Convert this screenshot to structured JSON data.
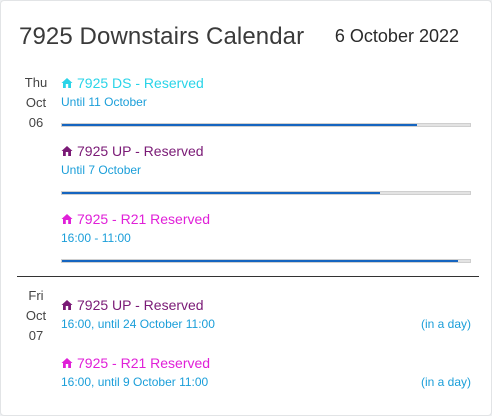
{
  "header": {
    "title": "7925 Downstairs Calendar",
    "date": "6 October 2022"
  },
  "days": [
    {
      "weekday": "Thu",
      "month": "Oct",
      "daynum": "06",
      "events": [
        {
          "icon": "house-icon",
          "title": "7925 DS - Reserved",
          "color": "#2ad4e8",
          "subtitle": "Until 11 October",
          "relative": "",
          "progress": 0.87
        },
        {
          "icon": "house-icon",
          "title": "7925 UP - Reserved",
          "color": "#7a1a76",
          "subtitle": "Until 7 October",
          "relative": "",
          "progress": 0.78
        },
        {
          "icon": "house-icon",
          "title": "7925 - R21 Reserved",
          "color": "#e020d8",
          "subtitle": "16:00 - 11:00",
          "relative": "",
          "progress": 0.97
        }
      ]
    },
    {
      "weekday": "Fri",
      "month": "Oct",
      "daynum": "07",
      "events": [
        {
          "icon": "house-icon",
          "title": "7925 UP - Reserved",
          "color": "#7a1a76",
          "subtitle": "16:00, until 24 October 11:00",
          "relative": "(in a day)"
        },
        {
          "icon": "house-icon",
          "title": "7925 - R21 Reserved",
          "color": "#e020d8",
          "subtitle": "16:00, until 9 October 11:00",
          "relative": "(in a day)"
        }
      ]
    }
  ]
}
